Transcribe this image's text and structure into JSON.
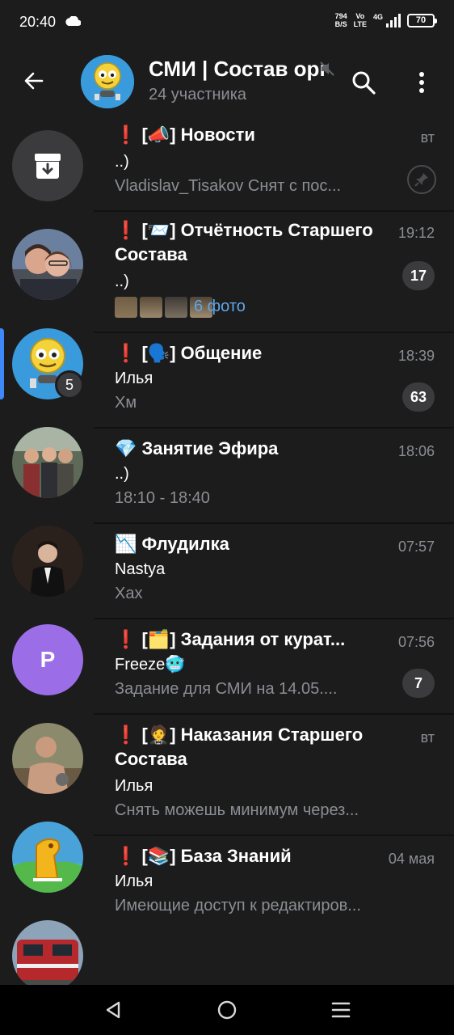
{
  "status": {
    "time": "20:40",
    "net_speed_value": "794",
    "net_speed_unit": "B/S",
    "volte_top": "Vo",
    "volte_bottom": "LTE",
    "network": "4G",
    "battery": "70"
  },
  "header": {
    "title": "СМИ | Состав орг",
    "subtitle": "24 участника"
  },
  "sidebar": {
    "active_badge": "5",
    "items": [
      {
        "name": "archive",
        "letter": ""
      },
      {
        "name": "couple-photo",
        "letter": ""
      },
      {
        "name": "smi-group",
        "letter": ""
      },
      {
        "name": "group-photo",
        "letter": ""
      },
      {
        "name": "suit-photo",
        "letter": ""
      },
      {
        "name": "letter-avatar",
        "letter": "P"
      },
      {
        "name": "man-photo",
        "letter": ""
      },
      {
        "name": "horse-logo",
        "letter": ""
      },
      {
        "name": "train-photo",
        "letter": ""
      }
    ]
  },
  "chats": [
    {
      "name": "❗ [📣] Новости",
      "time": "вт",
      "sender": "..)",
      "preview": "Vladislav_Tisakov Снят с пос...",
      "pinned": true
    },
    {
      "name": "❗ [📨] Отчётность Старшего Состава",
      "time": "19:12",
      "sender": "..)",
      "preview": "6 фото",
      "unread": "17"
    },
    {
      "name": "❗ [🗣️] Общение",
      "time": "18:39",
      "sender": "Илья",
      "preview": "Хм",
      "unread": "63"
    },
    {
      "name": "💎 Занятие Эфира",
      "time": "18:06",
      "sender": "..)",
      "preview": "18:10 - 18:40"
    },
    {
      "name": "📉 Флудилка",
      "time": "07:57",
      "sender": "Nastya",
      "preview": "Хах"
    },
    {
      "name": "❗ [🗂️] Задания от курат...",
      "time": "07:56",
      "sender": "Freeze🥶",
      "preview": "Задание для СМИ на 14.05....",
      "unread": "7"
    },
    {
      "name": "❗ [🤵] Наказания Старшего Состава",
      "time": "вт",
      "sender": "Илья",
      "preview": "Снять можешь минимум через..."
    },
    {
      "name": "❗ [📚] База Знаний",
      "time": "04 мая",
      "sender": "Илья",
      "preview": "Имеющие доступ к редактиров..."
    }
  ],
  "colors": {
    "background": "#1c1c1d",
    "accent": "#3e88f7",
    "link": "#5fa7e8",
    "muted_text": "#8b8e93",
    "badge": "#3b3b3d",
    "letter_avatar": "#9b6ee8"
  },
  "icons": [
    "back-arrow-icon",
    "mute-icon",
    "search-icon",
    "menu-dots-icon",
    "archive-icon",
    "pin-icon",
    "nav-back-icon",
    "nav-home-icon",
    "nav-recents-icon"
  ]
}
